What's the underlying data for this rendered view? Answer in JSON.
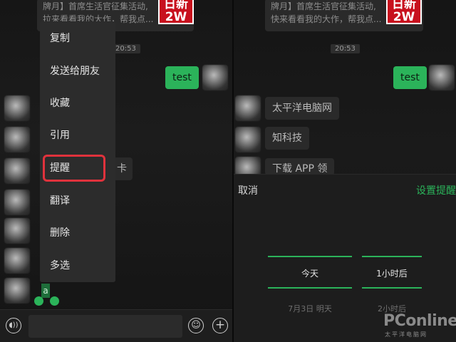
{
  "left": {
    "card": {
      "lines": [
        "牌月】首席生活官征集活动,",
        "拉来看看我的大作，帮我点..."
      ],
      "logo_lines": [
        "日新",
        "2W"
      ]
    },
    "time": "20:53",
    "sent_message": "test",
    "partial_bubble_char": "卡",
    "context_menu": [
      {
        "id": "copy",
        "label": "复制"
      },
      {
        "id": "send-to-friend",
        "label": "发送给朋友"
      },
      {
        "id": "favorite",
        "label": "收藏"
      },
      {
        "id": "quote",
        "label": "引用"
      },
      {
        "id": "remind",
        "label": "提醒"
      },
      {
        "id": "translate",
        "label": "翻译"
      },
      {
        "id": "delete",
        "label": "删除"
      },
      {
        "id": "multi-select",
        "label": "多选"
      }
    ],
    "selected_text": "a",
    "input_bar": {
      "voice_icon": "voice-icon",
      "emoji_icon": "emoji-icon",
      "plus_icon": "plus-icon",
      "voice_glyph": "◖))",
      "emoji_glyph": "☺",
      "plus_glyph": "+"
    }
  },
  "right": {
    "card": {
      "lines": [
        "牌月】首席生活官征集活动,",
        "快来看看我的大作，帮我点..."
      ],
      "logo_lines": [
        "日新",
        "2W"
      ]
    },
    "time": "20:53",
    "sent_message": "test",
    "messages": [
      "太平洋电脑网",
      "知科技",
      "下载 APP 领"
    ],
    "sheet": {
      "cancel": "取消",
      "confirm": "设置提醒",
      "date_column": {
        "selected": "今天",
        "next": "7月3日 明天"
      },
      "time_column": {
        "selected": "1小时后",
        "next": "2小时后"
      }
    }
  },
  "watermark": {
    "brand": "PConline",
    "sub": "太平洋电脑网"
  },
  "colors": {
    "accent_green": "#2bb35a",
    "highlight_red": "#e0323c",
    "logo_red": "#c8101e"
  }
}
